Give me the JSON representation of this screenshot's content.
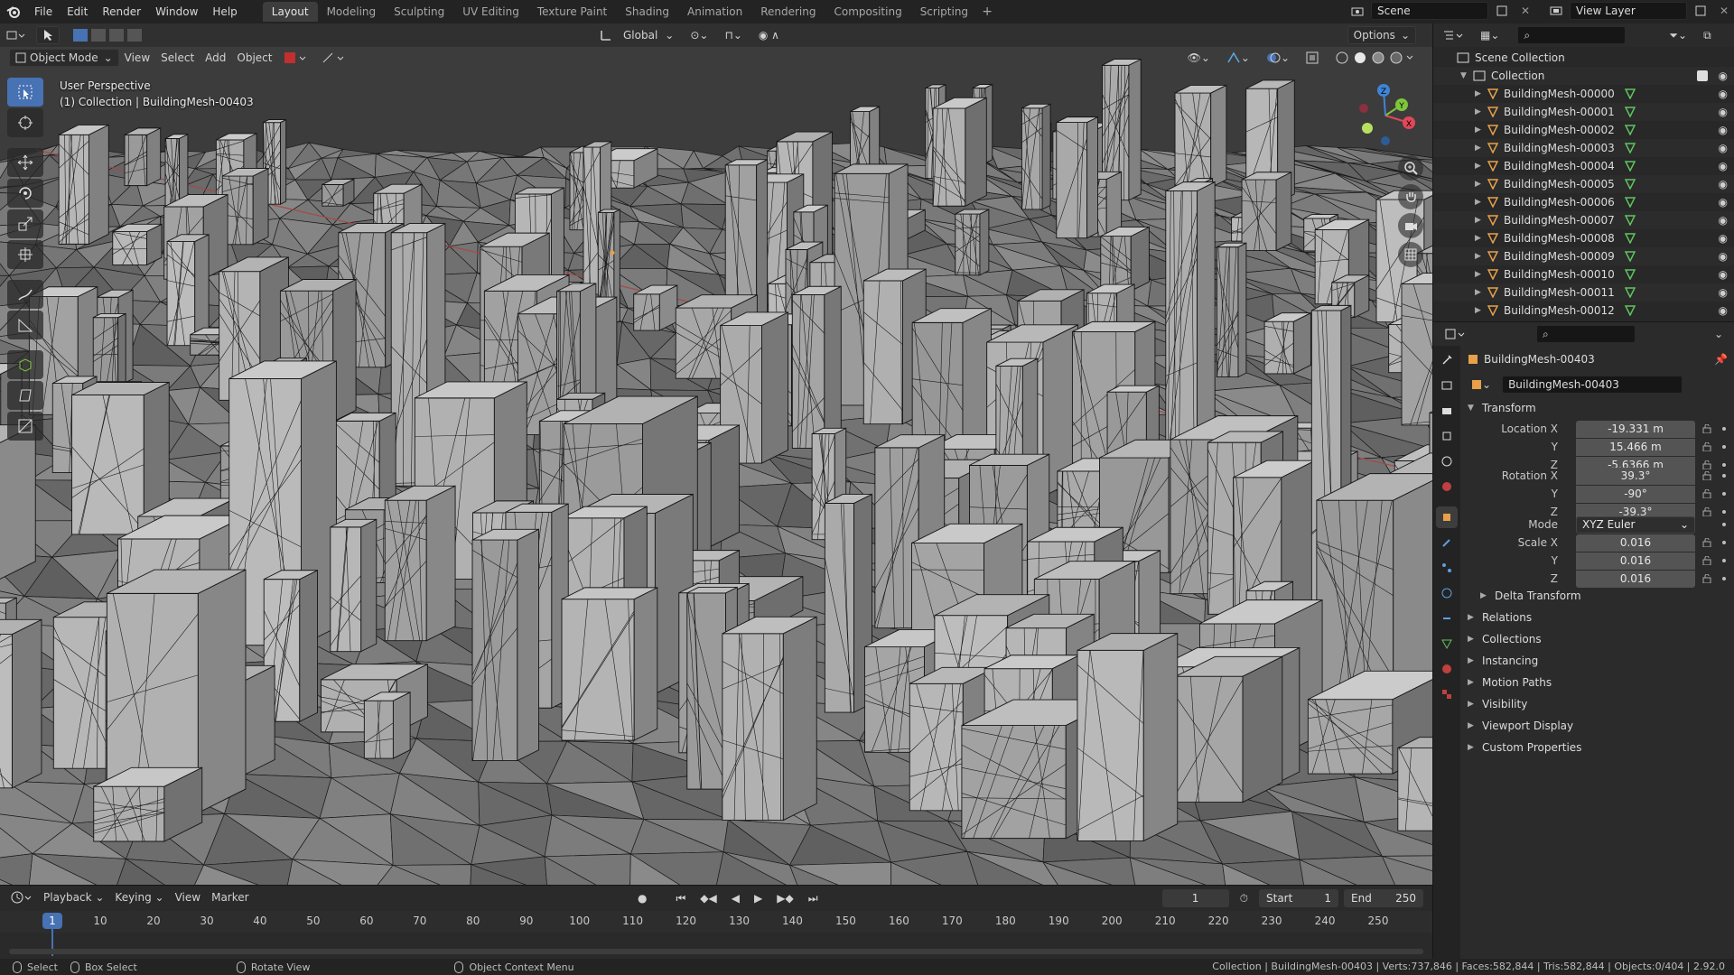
{
  "topbar": {
    "menus": [
      "File",
      "Edit",
      "Render",
      "Window",
      "Help"
    ],
    "workspaces": [
      "Layout",
      "Modeling",
      "Sculpting",
      "UV Editing",
      "Texture Paint",
      "Shading",
      "Animation",
      "Rendering",
      "Compositing",
      "Scripting"
    ],
    "active_workspace": "Layout",
    "scene": "Scene",
    "view_layer": "View Layer"
  },
  "viewport": {
    "mode": "Object Mode",
    "menus": [
      "View",
      "Select",
      "Add",
      "Object"
    ],
    "orientation": "Global",
    "options_label": "Options",
    "info_line1": "User Perspective",
    "info_line2": "(1) Collection | BuildingMesh-00403",
    "gizmo_axes": [
      "X",
      "Y",
      "Z"
    ]
  },
  "timeline": {
    "menus": [
      "Playback",
      "Keying",
      "View",
      "Marker"
    ],
    "current_frame": "1",
    "start_label": "Start",
    "start": "1",
    "end_label": "End",
    "end": "250",
    "ticks": [
      "1",
      "10",
      "20",
      "30",
      "40",
      "50",
      "60",
      "70",
      "80",
      "90",
      "100",
      "110",
      "120",
      "130",
      "140",
      "150",
      "160",
      "170",
      "180",
      "190",
      "200",
      "210",
      "220",
      "230",
      "240",
      "250"
    ]
  },
  "statusbar": {
    "select": "Select",
    "box_select": "Box Select",
    "rotate_view": "Rotate View",
    "context_menu": "Object Context Menu",
    "stats": "Collection | BuildingMesh-00403 | Verts:737,846 | Faces:582,844 | Tris:582,844 | Objects:0/404 | 2.92.0"
  },
  "outliner": {
    "scene_collection": "Scene Collection",
    "collection": "Collection",
    "items": [
      "BuildingMesh-00000",
      "BuildingMesh-00001",
      "BuildingMesh-00002",
      "BuildingMesh-00003",
      "BuildingMesh-00004",
      "BuildingMesh-00005",
      "BuildingMesh-00006",
      "BuildingMesh-00007",
      "BuildingMesh-00008",
      "BuildingMesh-00009",
      "BuildingMesh-00010",
      "BuildingMesh-00011",
      "BuildingMesh-00012"
    ]
  },
  "properties": {
    "object_name": "BuildingMesh-00403",
    "datablock_name": "BuildingMesh-00403",
    "transform_label": "Transform",
    "location_label": "Location X",
    "location": [
      "-19.331 m",
      "15.466 m",
      "-5.6366 m"
    ],
    "rotation_label": "Rotation X",
    "rotation": [
      "39.3°",
      "-90°",
      "-39.3°"
    ],
    "mode_label": "Mode",
    "mode_value": "XYZ Euler",
    "scale_label": "Scale X",
    "scale": [
      "0.016",
      "0.016",
      "0.016"
    ],
    "axis_y": "Y",
    "axis_z": "Z",
    "delta_transform": "Delta Transform",
    "panels": [
      "Relations",
      "Collections",
      "Instancing",
      "Motion Paths",
      "Visibility",
      "Viewport Display",
      "Custom Properties"
    ]
  },
  "colors": {
    "accent": "#4772b3",
    "mesh_orange": "#e8a04a",
    "mesh_green": "#5fc45f",
    "axis_x": "#e0475a",
    "axis_y": "#7ec63b",
    "axis_z": "#3f84d6"
  }
}
